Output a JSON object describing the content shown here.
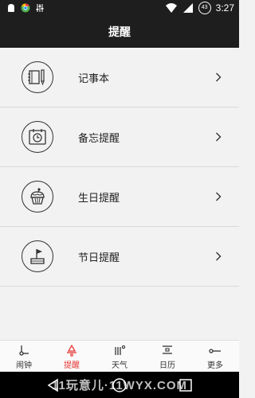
{
  "status_bar": {
    "time": "3:27",
    "battery": "43",
    "left_icons": [
      "android-icon",
      "chrome-icon",
      "equalizer-icon"
    ],
    "right_icons": [
      "wifi-icon",
      "signal-icon",
      "battery-icon"
    ]
  },
  "header": {
    "title": "提醒"
  },
  "list": {
    "items": [
      {
        "label": "记事本",
        "icon": "notebook-pen-icon"
      },
      {
        "label": "备忘提醒",
        "icon": "calendar-clock-icon"
      },
      {
        "label": "生日提醒",
        "icon": "cupcake-icon"
      },
      {
        "label": "节日提醒",
        "icon": "gift-icon"
      }
    ]
  },
  "tabbar": {
    "active_color": "#e53935",
    "tabs": [
      {
        "label": "闹钟",
        "icon": "alarm-icon",
        "active": false
      },
      {
        "label": "提醒",
        "icon": "bell-icon",
        "active": true
      },
      {
        "label": "天气",
        "icon": "weather-icon",
        "active": false
      },
      {
        "label": "日历",
        "icon": "calendar-icon",
        "active": false
      },
      {
        "label": "更多",
        "icon": "more-icon",
        "active": false
      }
    ]
  },
  "navbar": {
    "watermark": "11玩意儿·11WYX.COM",
    "buttons": [
      "back-icon",
      "home-icon",
      "recents-icon"
    ]
  }
}
